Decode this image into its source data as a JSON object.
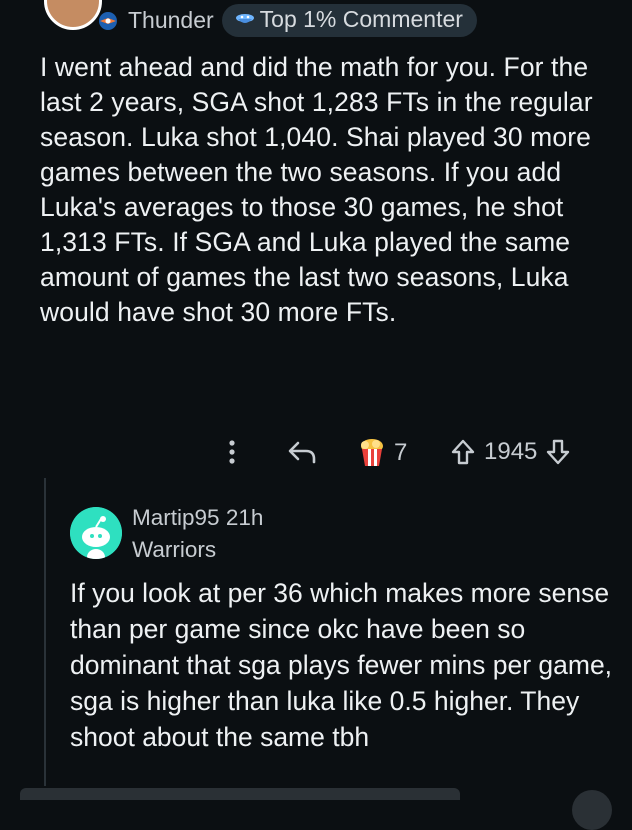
{
  "comment": {
    "author_flair": "Thunder",
    "badge": "Top 1% Commenter",
    "body": "I went ahead and did the math for you. For the last 2 years, SGA shot 1,283 FTs in the regular season. Luka shot 1,040. Shai played 30 more games between the two seasons. If you add Luka's averages to those 30 games, he shot 1,313 FTs. If SGA and Luka played the same amount of games the last two seasons, Luka would have shot 30 more FTs.",
    "award_count": "7",
    "vote_count": "1945"
  },
  "reply": {
    "username": "Martip95",
    "time": "21h",
    "flair": "Warriors",
    "body": "If you look at per 36 which makes more sense than per game since okc have been so dominant that sga plays fewer mins per game, sga is higher than luka like 0.5 higher. They shoot about the same tbh"
  },
  "colors": {
    "background": "#0b0f12",
    "text": "#eef1f3",
    "muted": "#c7ccd1",
    "badge_bg": "#243039",
    "reply_avatar": "#2ee0c0"
  },
  "icons": [
    "more-options-icon",
    "reply-icon",
    "award-icon",
    "upvote-icon",
    "downvote-icon",
    "thunder-logo-icon",
    "top-commenter-icon",
    "snoo-avatar-icon"
  ]
}
